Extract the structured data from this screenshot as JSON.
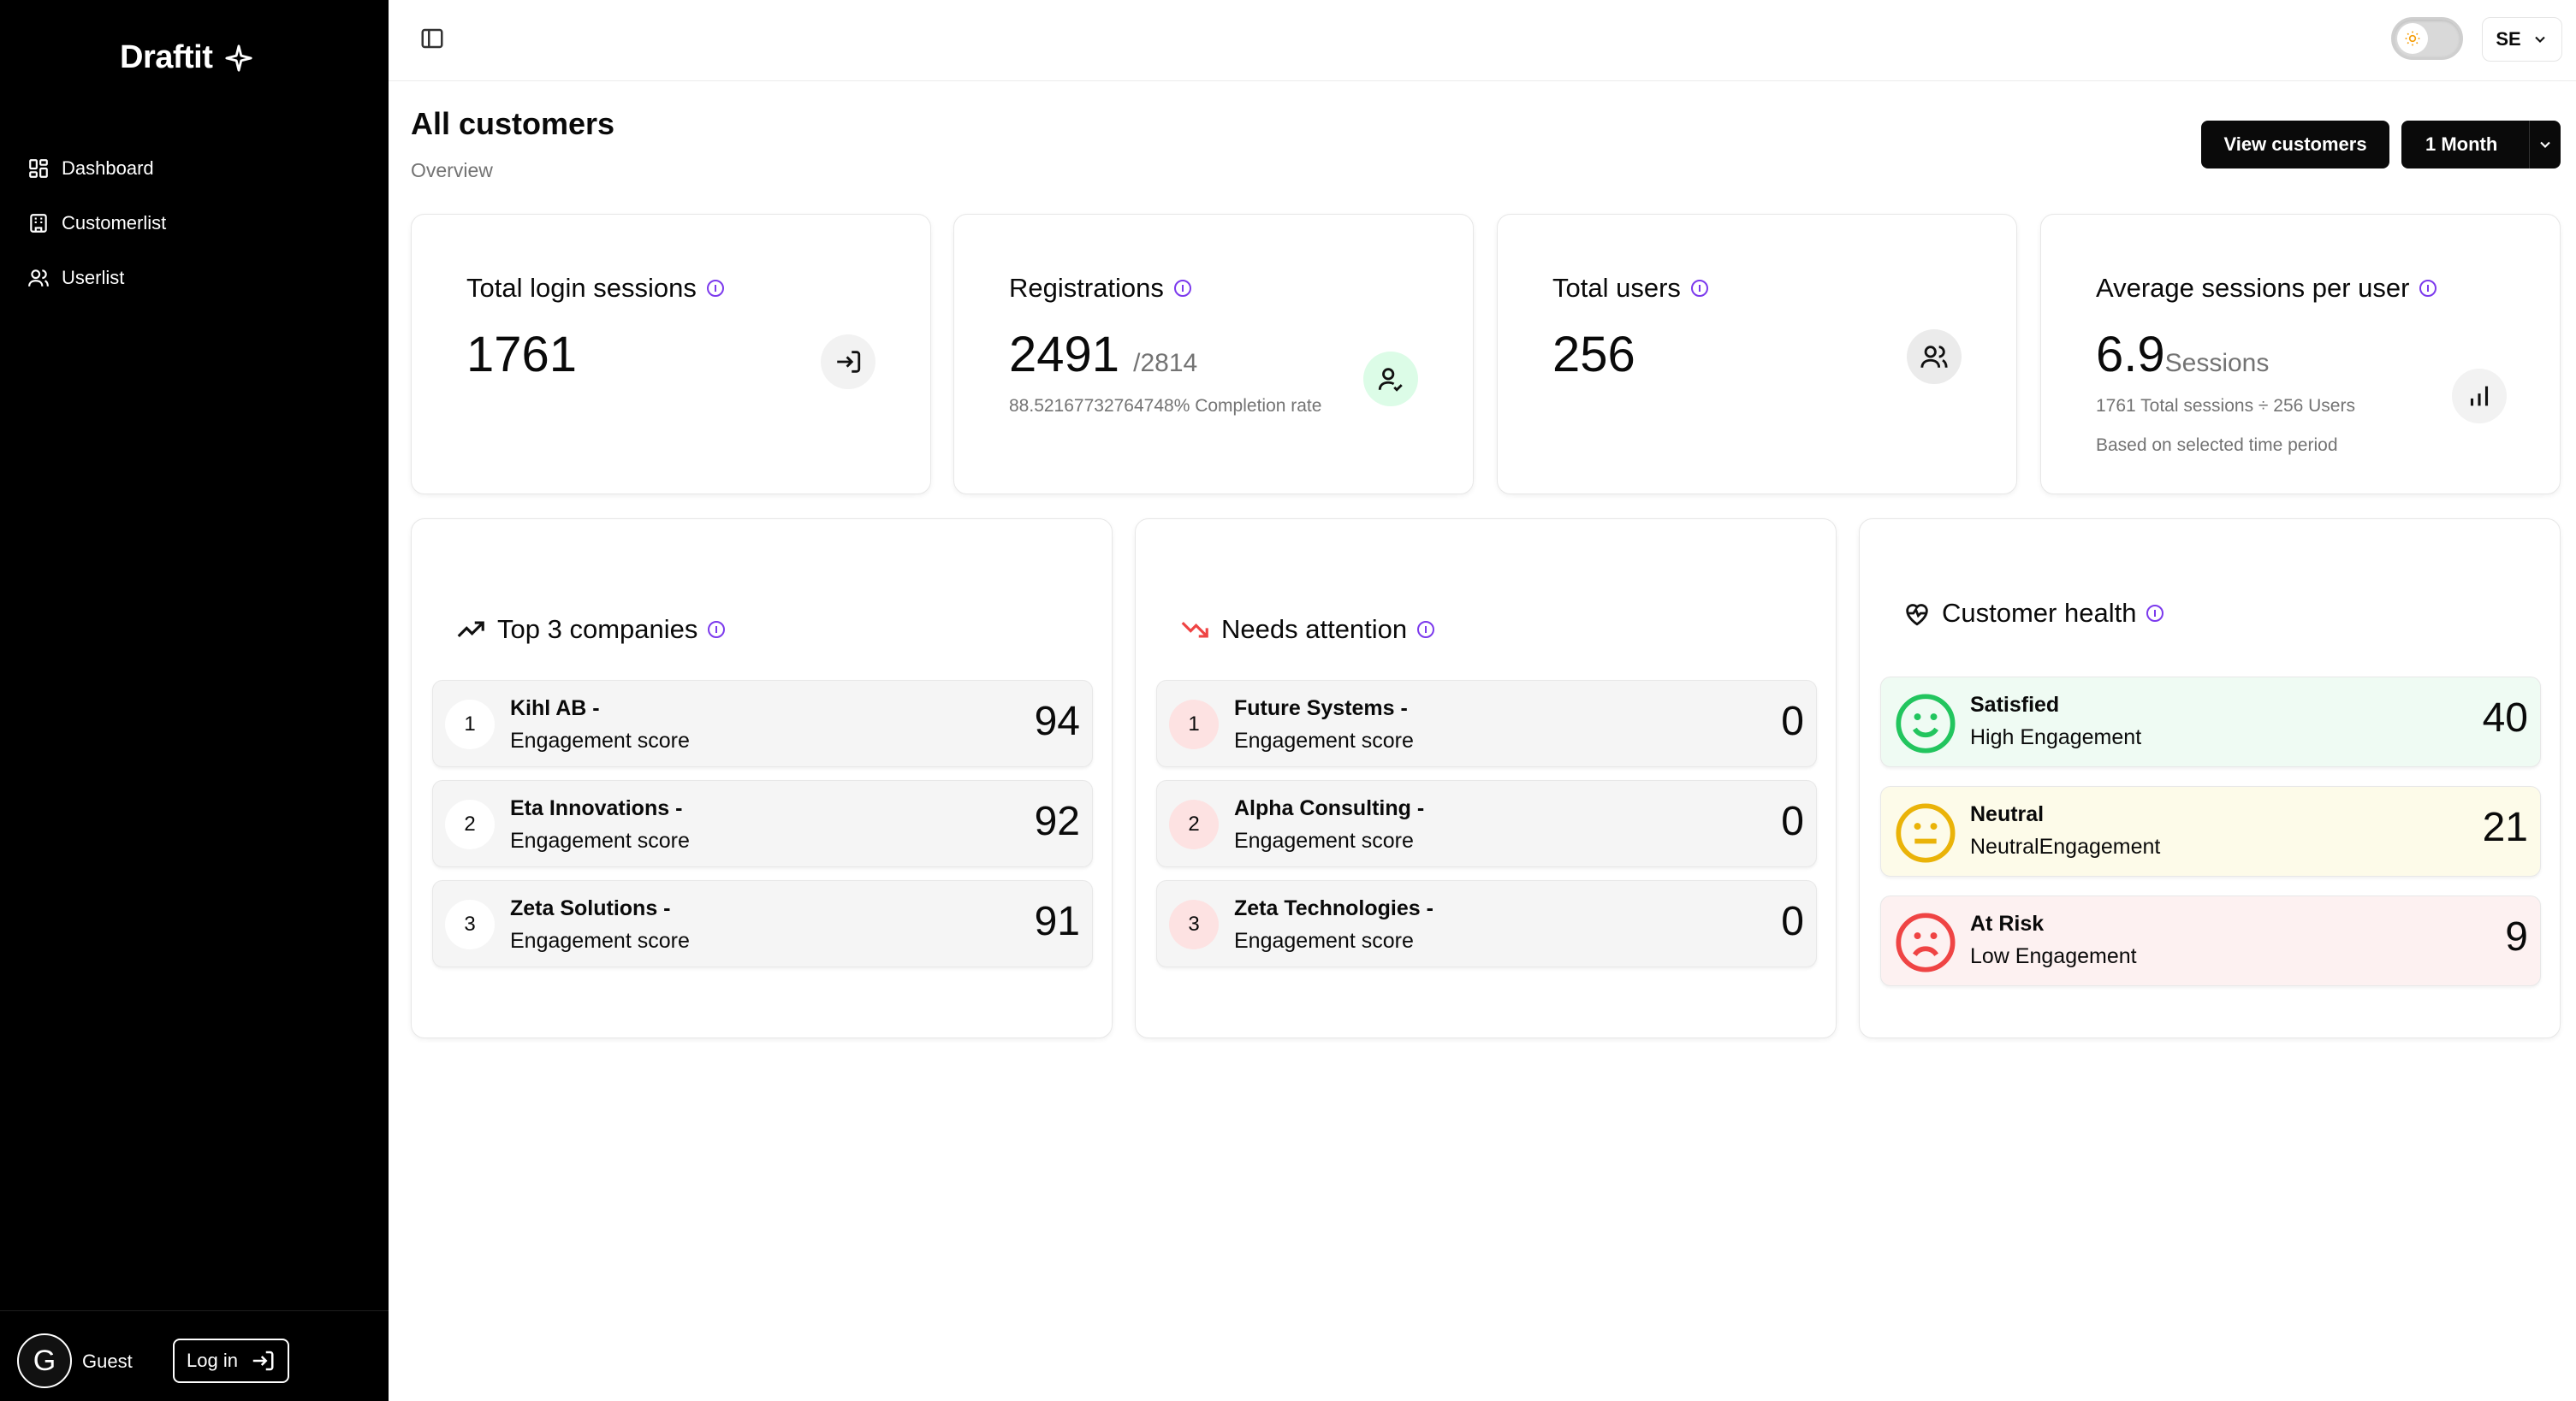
{
  "app": {
    "brand": "Draftit"
  },
  "sidebar": {
    "items": [
      {
        "label": "Dashboard",
        "icon": "dashboard-icon"
      },
      {
        "label": "Customerlist",
        "icon": "building-icon"
      },
      {
        "label": "Userlist",
        "icon": "users-icon"
      }
    ],
    "user": {
      "initial": "G",
      "name": "Guest",
      "login_label": "Log in"
    }
  },
  "topbar": {
    "language": "SE"
  },
  "header": {
    "title": "All customers",
    "subtitle": "Overview",
    "view_button": "View customers",
    "period": "1 Month"
  },
  "stats": {
    "login_sessions": {
      "title": "Total login sessions",
      "value": "1761"
    },
    "registrations": {
      "title": "Registrations",
      "value": "2491",
      "total": "/2814",
      "note": "88.52167732764748% Completion rate"
    },
    "total_users": {
      "title": "Total users",
      "value": "256"
    },
    "avg_sessions": {
      "title": "Average sessions per user",
      "value": "6.9",
      "unit": "Sessions",
      "note1": "1761 Total sessions ÷ 256 Users",
      "note2": "Based on selected time period"
    }
  },
  "top_companies": {
    "title": "Top 3 companies",
    "rows": [
      {
        "rank": "1",
        "name": "Kihl AB -",
        "sub": "Engagement score",
        "score": "94"
      },
      {
        "rank": "2",
        "name": "Eta Innovations -",
        "sub": "Engagement score",
        "score": "92"
      },
      {
        "rank": "3",
        "name": "Zeta Solutions -",
        "sub": "Engagement score",
        "score": "91"
      }
    ]
  },
  "needs_attention": {
    "title": "Needs attention",
    "rows": [
      {
        "rank": "1",
        "name": "Future Systems -",
        "sub": "Engagement score",
        "score": "0"
      },
      {
        "rank": "2",
        "name": "Alpha Consulting -",
        "sub": "Engagement score",
        "score": "0"
      },
      {
        "rank": "3",
        "name": "Zeta Technologies -",
        "sub": "Engagement score",
        "score": "0"
      }
    ]
  },
  "customer_health": {
    "title": "Customer health",
    "rows": [
      {
        "label": "Satisfied",
        "sub": "High Engagement",
        "count": "40",
        "color": "#22c55e"
      },
      {
        "label": "Neutral",
        "sub": "NeutralEngagement",
        "count": "21",
        "color": "#eab308"
      },
      {
        "label": "At Risk",
        "sub": "Low Engagement",
        "count": "9",
        "color": "#ef4444"
      }
    ]
  }
}
